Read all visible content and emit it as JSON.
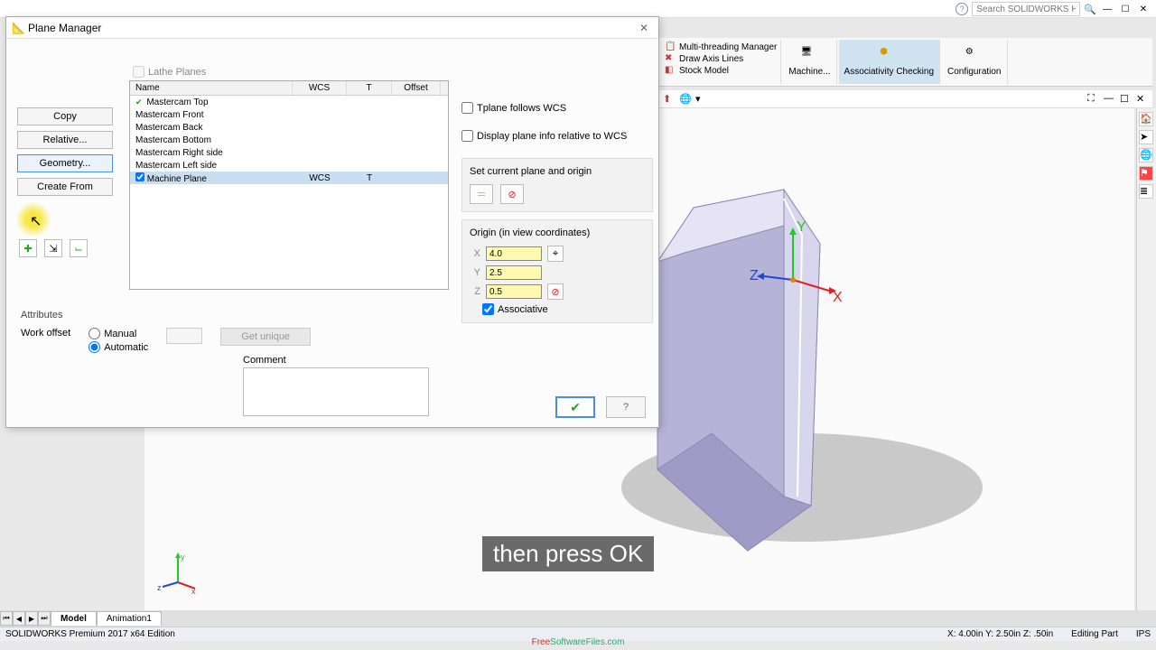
{
  "title_search_placeholder": "Search SOLIDWORKS Help",
  "ribbon": {
    "list": [
      {
        "label": "Multi-threading Manager"
      },
      {
        "label": "Draw Axis Lines"
      },
      {
        "label": "Stock Model"
      }
    ],
    "btns": [
      {
        "label": "Machine..."
      },
      {
        "label": "Associativity Checking",
        "active": true
      },
      {
        "label": "Configuration"
      }
    ]
  },
  "dialog": {
    "title": "Plane Manager",
    "lathe_planes": "Lathe Planes",
    "left_buttons": {
      "copy": "Copy",
      "relative": "Relative...",
      "geometry": "Geometry...",
      "create_from": "Create From"
    },
    "table": {
      "headers": {
        "name": "Name",
        "wcs": "WCS",
        "t": "T",
        "offset": "Offset"
      },
      "rows": [
        {
          "name": "Mastercam Top",
          "check": true
        },
        {
          "name": "Mastercam Front"
        },
        {
          "name": "Mastercam Back"
        },
        {
          "name": "Mastercam Bottom"
        },
        {
          "name": "Mastercam Right side"
        },
        {
          "name": "Mastercam Left side"
        },
        {
          "name": "Machine Plane",
          "wcs": "WCS",
          "t": "T",
          "selected": true
        }
      ]
    },
    "tplane_follows": "Tplane follows WCS",
    "display_plane": "Display plane info relative to WCS",
    "set_current": "Set current plane and origin",
    "origin_label": "Origin (in view coordinates)",
    "origin": {
      "x": "4.0",
      "y": "2.5",
      "z": "0.5"
    },
    "associative": "Associative",
    "attributes": "Attributes",
    "work_offset": "Work offset",
    "manual": "Manual",
    "automatic": "Automatic",
    "get_unique": "Get unique",
    "comment": "Comment"
  },
  "tabs": {
    "model": "Model",
    "animation": "Animation1"
  },
  "status": {
    "left": "SOLIDWORKS Premium 2017 x64 Edition",
    "coords": "X: 4.00in Y: 2.50in Z: .50in",
    "editing": "Editing Part",
    "units": "IPS"
  },
  "caption": "then press OK",
  "watermark": {
    "free": "Free",
    "rest": "SoftwareFiles.com"
  }
}
